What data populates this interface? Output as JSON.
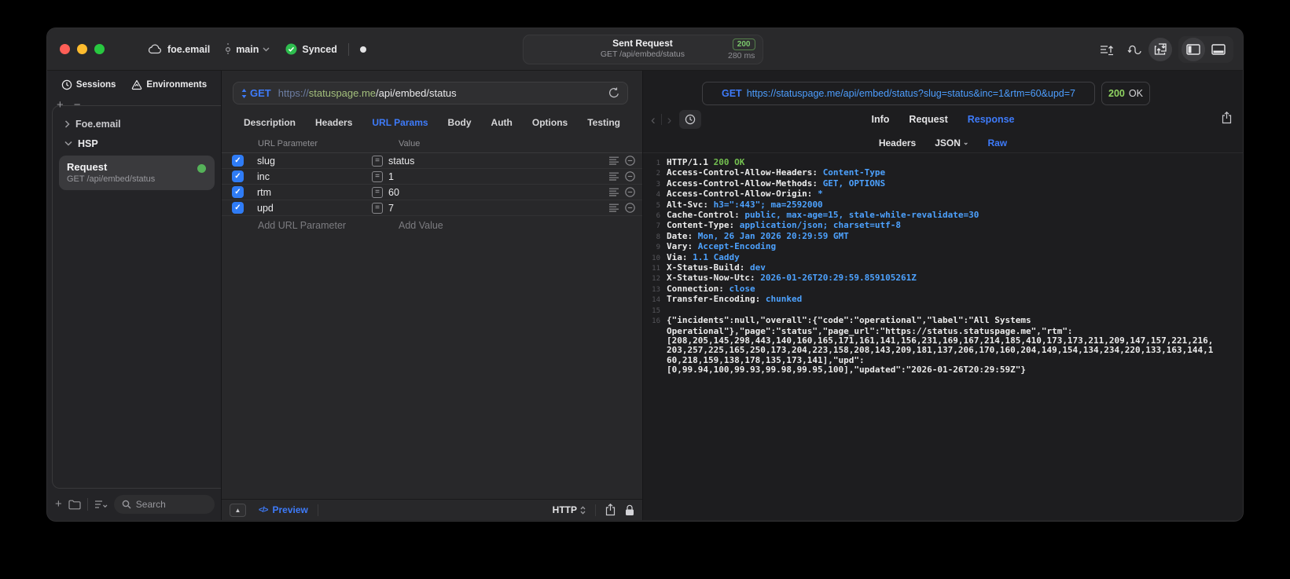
{
  "titlebar": {
    "project": "foe.email",
    "branch": "main",
    "sync_label": "Synced",
    "center": {
      "title": "Sent Request",
      "subtitle": "GET /api/embed/status",
      "status_code": "200",
      "duration": "280 ms"
    }
  },
  "sidebar": {
    "tabs": [
      {
        "label": "Sessions",
        "icon": "clock-icon"
      },
      {
        "label": "Environments",
        "icon": "environments-icon"
      }
    ],
    "tree": [
      {
        "label": "Foe.email",
        "expanded": false
      },
      {
        "label": "HSP",
        "expanded": true
      }
    ],
    "request_item": {
      "title": "Request",
      "subtitle": "GET /api/embed/status",
      "status_dot_color": "#55b259"
    },
    "search_placeholder": "Search"
  },
  "request_pane": {
    "method": "GET",
    "url": {
      "scheme": "https://",
      "host": "statuspage.me",
      "path": "/api/embed/status"
    },
    "tabs": [
      "Description",
      "Headers",
      "URL Params",
      "Body",
      "Auth",
      "Options",
      "Testing"
    ],
    "active_tab": "URL Params",
    "params": {
      "columns": [
        "URL Parameter",
        "Value"
      ],
      "rows": [
        {
          "enabled": true,
          "name": "slug",
          "value": "status"
        },
        {
          "enabled": true,
          "name": "inc",
          "value": "1"
        },
        {
          "enabled": true,
          "name": "rtm",
          "value": "60"
        },
        {
          "enabled": true,
          "name": "upd",
          "value": "7"
        }
      ],
      "add_name_placeholder": "Add URL Parameter",
      "add_value_placeholder": "Add Value"
    },
    "footer": {
      "preview_label": "Preview",
      "protocol_label": "HTTP"
    }
  },
  "response_pane": {
    "request_line": {
      "method": "GET",
      "url": "https://statuspage.me/api/embed/status?slug=status&inc=1&rtm=60&upd=7"
    },
    "status": {
      "code": "200",
      "text": "OK"
    },
    "tabs": [
      "Info",
      "Request",
      "Response"
    ],
    "active_tab": "Response",
    "subtabs": [
      "Headers",
      "JSON",
      "Raw"
    ],
    "dropdown_subtab": "JSON",
    "active_subtab": "Raw",
    "raw": {
      "status_line": {
        "protocol": "HTTP/1.1",
        "status": "200 OK"
      },
      "headers": [
        {
          "name": "Access-Control-Allow-Headers",
          "value": "Content-Type"
        },
        {
          "name": "Access-Control-Allow-Methods",
          "value": "GET, OPTIONS"
        },
        {
          "name": "Access-Control-Allow-Origin",
          "value": "*"
        },
        {
          "name": "Alt-Svc",
          "value": "h3=\":443\"; ma=2592000"
        },
        {
          "name": "Cache-Control",
          "value": "public, max-age=15, stale-while-revalidate=30"
        },
        {
          "name": "Content-Type",
          "value": "application/json; charset=utf-8"
        },
        {
          "name": "Date",
          "value": "Mon, 26 Jan 2026 20:29:59 GMT"
        },
        {
          "name": "Vary",
          "value": "Accept-Encoding"
        },
        {
          "name": "Via",
          "value": "1.1 Caddy"
        },
        {
          "name": "X-Status-Build",
          "value": "dev"
        },
        {
          "name": "X-Status-Now-Utc",
          "value": "2026-01-26T20:29:59.859105261Z"
        },
        {
          "name": "Connection",
          "value": "close"
        },
        {
          "name": "Transfer-Encoding",
          "value": "chunked"
        }
      ],
      "body_line_number": "16",
      "body_lines": [
        "{\"incidents\":null,\"overall\":{\"code\":\"operational\",\"label\":\"All Systems",
        "Operational\"},\"page\":\"status\",\"page_url\":\"https://status.statuspage.me\",\"rtm\":",
        "[208,205,145,298,443,140,160,165,171,161,141,156,231,169,167,214,185,410,173,173,211,209,147,157,221,216,",
        "203,257,225,165,250,173,204,223,158,208,143,209,181,137,206,170,160,204,149,154,134,234,220,133,163,144,1",
        "60,218,159,138,178,135,173,141],\"upd\":",
        "[0,99.94,100,99.93,99.98,99.95,100],\"updated\":\"2026-01-26T20:29:59Z\"}"
      ]
    }
  },
  "colors": {
    "accent_blue": "#3e7bfa",
    "code_value_blue": "#4da2ff",
    "code_green": "#74c050",
    "badge_green": "#7bc86c",
    "checkbox_blue": "#2f7cf6"
  }
}
